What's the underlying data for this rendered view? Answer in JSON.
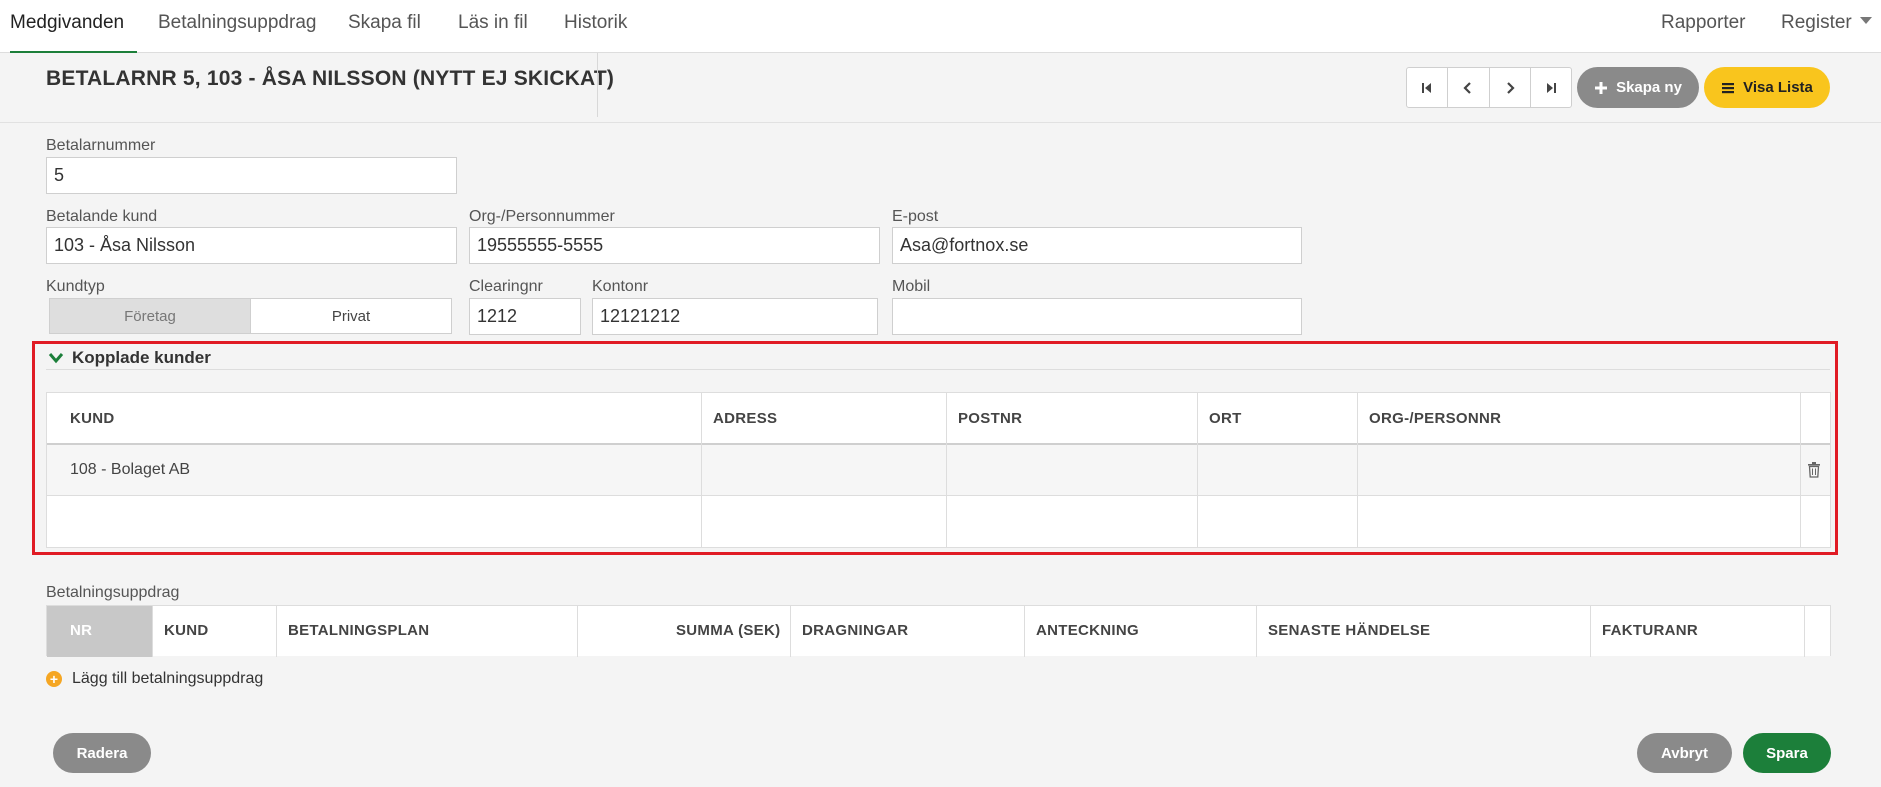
{
  "nav": {
    "tabs": [
      {
        "label": "Medgivanden",
        "active": true
      },
      {
        "label": "Betalningsuppdrag"
      },
      {
        "label": "Skapa fil"
      },
      {
        "label": "Läs in fil"
      },
      {
        "label": "Historik"
      }
    ],
    "right": {
      "reports": "Rapporter",
      "register": "Register"
    }
  },
  "header": {
    "title": "BETALARNR 5, 103 - ÅSA NILSSON (NYTT EJ SKICKAT)",
    "create_new": "Skapa ny",
    "show_list": "Visa Lista"
  },
  "form": {
    "payer_number_label": "Betalarnummer",
    "payer_number": "5",
    "paying_customer_label": "Betalande kund",
    "paying_customer": "103 - Åsa Nilsson",
    "org_number_label": "Org-/Personnummer",
    "org_number": "19555555-5555",
    "email_label": "E-post",
    "email": "Asa@fortnox.se",
    "customer_type_label": "Kundtyp",
    "customer_type_options": [
      "Företag",
      "Privat"
    ],
    "clearing_label": "Clearingnr",
    "clearing": "1212",
    "account_label": "Kontonr",
    "account": "12121212",
    "mobile_label": "Mobil",
    "mobile": ""
  },
  "linked_customers": {
    "title": "Kopplade kunder",
    "columns": [
      "KUND",
      "ADRESS",
      "POSTNR",
      "ORT",
      "ORG-/PERSONNR"
    ],
    "rows": [
      {
        "kund": "108 - Bolaget AB",
        "adress": "",
        "postnr": "",
        "ort": "",
        "orgnr": ""
      }
    ]
  },
  "payment_orders": {
    "title": "Betalningsuppdrag",
    "columns": [
      "NR",
      "KUND",
      "BETALNINGSPLAN",
      "SUMMA (SEK)",
      "DRAGNINGAR",
      "ANTECKNING",
      "SENASTE HÄNDELSE",
      "FAKTURANR"
    ],
    "add_label": "Lägg till betalningsuppdrag"
  },
  "footer": {
    "delete": "Radera",
    "cancel": "Avbryt",
    "save": "Spara"
  }
}
